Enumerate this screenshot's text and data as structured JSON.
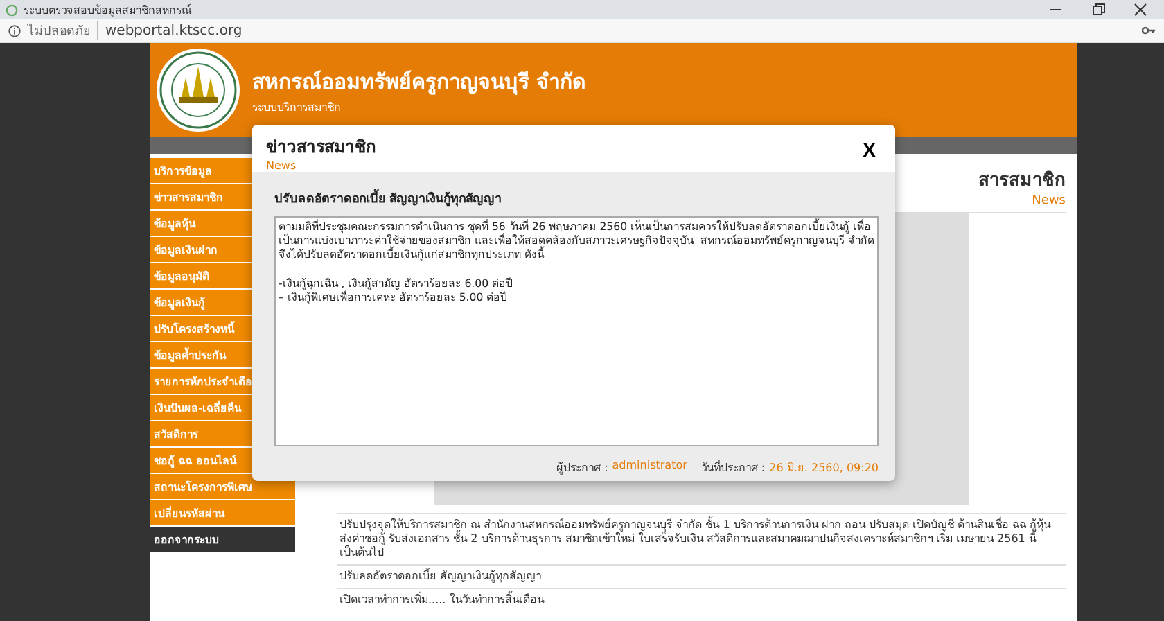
{
  "browser": {
    "tab_title": "ระบบตรวจสอบข้อมูลสมาชิกสหกรณ์",
    "security": "ไม่ปลอดภัย",
    "url": "webportal.ktscc.org"
  },
  "header": {
    "title": "สหกรณ์ออมทรัพย์ครูกาญจนบุรี จำกัด",
    "subtitle": "ระบบบริการสมาชิก"
  },
  "sidebar": {
    "items": [
      {
        "label": "บริการข้อมูล",
        "kind": "menu"
      },
      {
        "label": "ข่าวสารสมาชิก",
        "kind": "menu"
      },
      {
        "label": "ข้อมูลหุ้น",
        "kind": "menu"
      },
      {
        "label": "ข้อมูลเงินฝาก",
        "kind": "menu"
      },
      {
        "label": "ข้อมูลอนุมัติ",
        "kind": "menu"
      },
      {
        "label": "ข้อมูลเงินกู้",
        "kind": "menu"
      },
      {
        "label": "ปรับโครงสร้างหนี้",
        "kind": "menu"
      },
      {
        "label": "ข้อมูลค้ำประกัน",
        "kind": "menu"
      },
      {
        "label": "รายการหักประจำเดือ",
        "kind": "menu"
      },
      {
        "label": "เงินปันผล-เฉลี่ยคืน",
        "kind": "menu"
      },
      {
        "label": "สวัสดิการ",
        "kind": "menu"
      },
      {
        "label": "ชอกู้ ฉฉ ออนไลน์",
        "kind": "menu"
      },
      {
        "label": "สถานะโครงการพิเศษ",
        "kind": "menu"
      },
      {
        "label": "เปลี่ยนรหัสผ่าน",
        "kind": "menu"
      },
      {
        "label": "ออกจากระบบ",
        "kind": "logout"
      }
    ]
  },
  "content": {
    "title": "สารสมาชิก",
    "subtitle": "News",
    "news": [
      "ปรับปรุงจุดให้บริการสมาชิก ณ สำนักงานสหกรณ์ออมทรัพย์ครูกาญจนบุรี จำกัด ชั้น 1 บริการด้านการเงิน ฝาก ถอน ปรับสมุด เปิดบัญชี ด้านสินเชื่อ ฉฉ กู้หุ้น ส่งค่าชอกู้ รับส่งเอกสาร ชั้น 2 บริการด้านธุรการ สมาชิกเข้าใหม่ ใบเสร็จรับเงิน สวัสดิการและสมาคมฌาปนกิจสงเคราะห์สมาชิกฯ เริ่ม เมษายน 2561 นี้เป็นต้นไป",
      "ปรับลดอัตราดอกเบี้ย สัญญาเงินกู้ทุกสัญญา",
      "เปิดเวลาทำการเพิ่ม..... ในวันทำการสิ้นเดือน"
    ]
  },
  "modal": {
    "title": "ข่าวสารสมาชิก",
    "subtitle": "News",
    "close": "X",
    "subject": "ปรับลดอัตราดอกเบี้ย สัญญาเงินกู้ทุกสัญญา",
    "body": "ตามมติที่ประชุมคณะกรรมการดำเนินการ ชุดที่ 56 วันที่ 26 พฤษภาคม 2560 เห็นเป็นการสมควรให้ปรับลดอัตราดอกเบี้ยเงินกู้ เพื่อเป็นการแบ่งเบาภาระค่าใช้จ่ายของสมาชิก และเพื่อให้สอดคล้องกับสภาวะเศรษฐกิจปัจจุบัน  สหกรณ์ออมทรัพย์ครูกาญจนบุรี จำกัด จึงได้ปรับลดอัตราดอกเบี้ยเงินกู้แก่สมาชิกทุกประเภท ดังนี้\n\n-เงินกู้ฉุกเฉิน , เงินกู้สามัญ อัตราร้อยละ 6.00 ต่อปี\n– เงินกู้พิเศษเพื่อการเคหะ อัตราร้อยละ 5.00 ต่อปี",
    "author_label": "ผู้ประกาศ :",
    "author": "administrator",
    "date_label": "วันที่ประกาศ :",
    "date": "26 มิ.ย. 2560, 09:20"
  }
}
